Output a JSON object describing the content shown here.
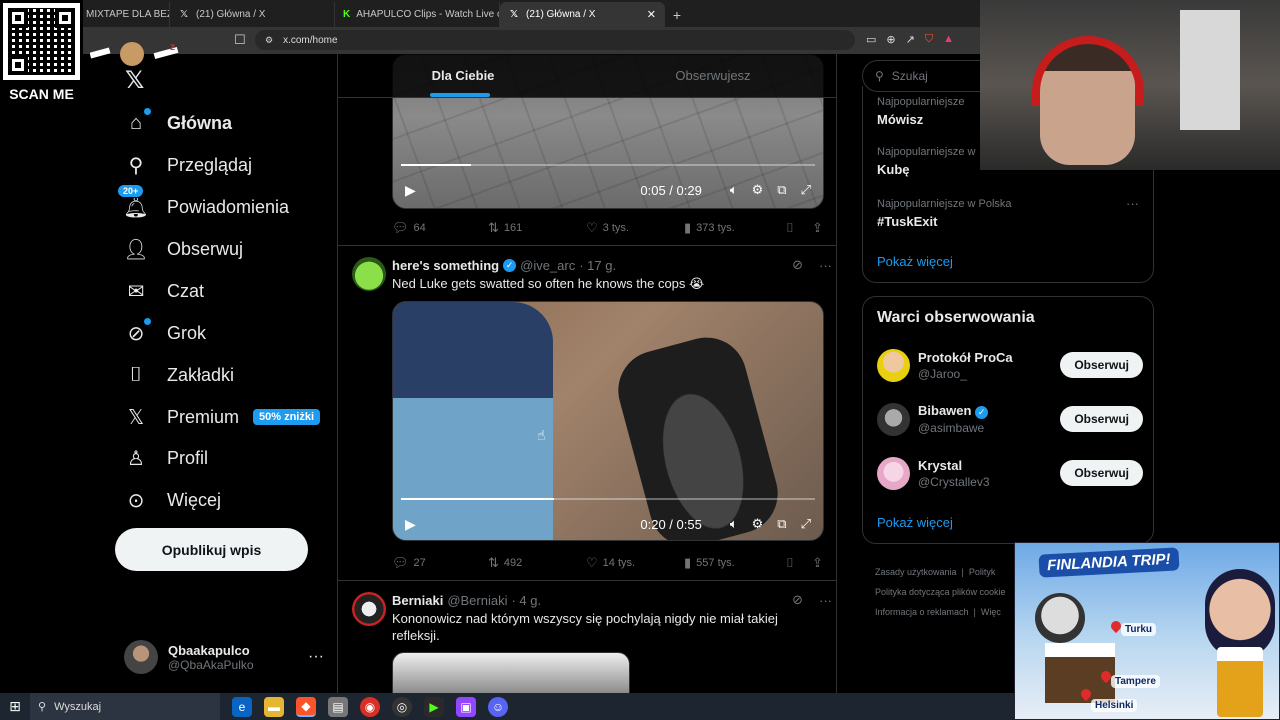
{
  "browser": {
    "tabs": [
      {
        "label": "MIXTAPE DLA BEZRO",
        "icon": "x"
      },
      {
        "label": "(21) Główna / X",
        "icon": "x"
      },
      {
        "label": "AHAPULCO Clips - Watch Live on Kick",
        "icon": "kick"
      },
      {
        "label": "(21) Główna / X",
        "icon": "x",
        "active": true
      }
    ],
    "url": "x.com/home"
  },
  "overlay": {
    "qr_label": "SCAN ME"
  },
  "nav": {
    "items": [
      {
        "label": "Główna",
        "icon": "home-icon"
      },
      {
        "label": "Przeglądaj",
        "icon": "search-icon"
      },
      {
        "label": "Powiadomienia",
        "icon": "bell-icon",
        "badge": "20+"
      },
      {
        "label": "Obserwuj",
        "icon": "add-person-icon"
      },
      {
        "label": "Czat",
        "icon": "mail-icon"
      },
      {
        "label": "Grok",
        "icon": "grok-icon"
      },
      {
        "label": "Zakładki",
        "icon": "bookmark-icon"
      },
      {
        "label": "Premium",
        "icon": "x-icon",
        "badge": "50% zniżki"
      },
      {
        "label": "Profil",
        "icon": "person-icon"
      },
      {
        "label": "Więcej",
        "icon": "more-circle-icon"
      }
    ],
    "post_button": "Opublikuj wpis",
    "profile": {
      "name": "Qbaakapulco",
      "handle": "@QbaAkaPulko"
    }
  },
  "feed": {
    "tabs": [
      "Dla Ciebie",
      "Obserwujesz"
    ],
    "post1": {
      "video_time": "0:05 / 0:29",
      "video_progress": 0.17,
      "replies": "64",
      "reposts": "161",
      "likes": "3 tys.",
      "views": "373 tys."
    },
    "post2": {
      "name": "here's something",
      "handle": "@ive_arc",
      "time": "· 17 g.",
      "text": "Ned Luke gets swatted so often he knows the cops 😭",
      "video_time": "0:20 / 0:55",
      "video_progress": 0.37,
      "replies": "27",
      "reposts": "492",
      "likes": "14 tys.",
      "views": "557 tys."
    },
    "post3": {
      "name": "Berniaki",
      "handle": "@Berniaki",
      "time": "· 4 g.",
      "text": "Kononowicz nad którym wszyscy się pochylają nigdy nie miał takiej refleksji."
    }
  },
  "sidebar": {
    "search_placeholder": "Szukaj",
    "trends": [
      {
        "context": "Najpopularniejsze",
        "title": "Mówisz"
      },
      {
        "context": "Najpopularniejsze w",
        "title": "Kubę"
      },
      {
        "context": "Najpopularniejsze w Polska",
        "title": "#TuskExit"
      }
    ],
    "show_more": "Pokaż więcej",
    "who_to_follow_title": "Warci obserwowania",
    "who_to_follow": [
      {
        "name": "Protokół ProCa",
        "handle": "@Jaroo_",
        "verified": false
      },
      {
        "name": "Bibawen",
        "handle": "@asimbawe",
        "verified": true
      },
      {
        "name": "Krystal",
        "handle": "@Crystallev3",
        "verified": false
      }
    ],
    "follow_label": "Obserwuj",
    "show_more_2": "Pokaż więcej",
    "footer": [
      "Zasady użytkowania",
      "Polityk",
      "Polityka dotycząca plików cookie",
      "Informacja o reklamach",
      "Więc"
    ]
  },
  "promo": {
    "title": "FINLANDIA TRIP!",
    "cities": [
      "Turku",
      "Tampere",
      "Helsinki"
    ]
  },
  "taskbar": {
    "search": "Wyszukaj"
  },
  "colors": {
    "accent": "#1d9bf0",
    "background": "#000000",
    "border": "#2f3336",
    "muted": "#71767b"
  }
}
